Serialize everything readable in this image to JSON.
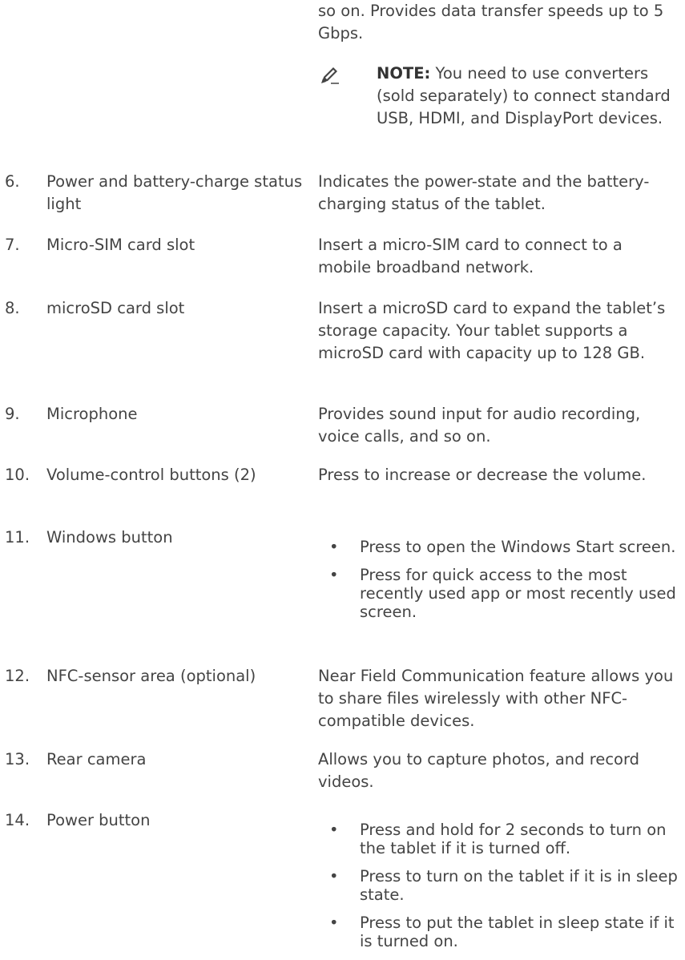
{
  "intro_text": "so on. Provides data transfer speeds up to 5 Gbps.",
  "note": {
    "icon": "pencil-note-icon",
    "label": "NOTE:",
    "text": " You need to use converters (sold separately) to connect standard USB, HDMI, and DisplayPort devices."
  },
  "bullet_char": "•",
  "items": [
    {
      "num": "6.",
      "term": "Power and battery-charge status light",
      "desc": "Indicates the power-state and the battery-charging status of the tablet."
    },
    {
      "num": "7.",
      "term": "Micro-SIM card slot",
      "desc": "Insert a micro-SIM card to connect to a mobile broadband network."
    },
    {
      "num": "8.",
      "term": "microSD card slot",
      "desc": "Insert a microSD card to expand the tablet’s storage capacity. Your tablet supports a microSD card with capacity up to 128 GB."
    },
    {
      "num": "9.",
      "term": "Microphone",
      "desc": "Provides sound input for audio recording, voice calls, and so on."
    },
    {
      "num": "10.",
      "term": "Volume-control buttons (2)",
      "desc": "Press to increase or decrease the volume."
    },
    {
      "num": "11.",
      "term": "Windows button",
      "bullets": [
        "Press to open the Windows Start screen.",
        "Press for quick access to the most recently used app or most recently used screen."
      ]
    },
    {
      "num": "12.",
      "term": "NFC-sensor area (optional)",
      "desc": "Near Field Communication feature allows you to share files wirelessly with other NFC-compatible devices."
    },
    {
      "num": "13.",
      "term": "Rear camera",
      "desc": "Allows you to capture photos, and record videos."
    },
    {
      "num": "14.",
      "term": "Power button",
      "bullets": [
        "Press and hold for 2 seconds to turn on the tablet if it is turned off.",
        "Press to turn on the tablet if it is in sleep state.",
        "Press to put the tablet in sleep state if it is turned on."
      ]
    }
  ]
}
